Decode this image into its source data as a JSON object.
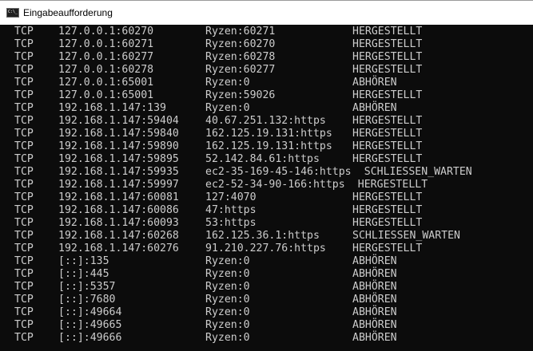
{
  "window": {
    "title": "Eingabeaufforderung",
    "icon": "cmd-icon"
  },
  "colors": {
    "background": "#0c0c0c",
    "text": "#cccccc",
    "titlebar": "#ffffff"
  },
  "connections": [
    [
      "TCP",
      "127.0.0.1:60270",
      "Ryzen:60271",
      "HERGESTELLT"
    ],
    [
      "TCP",
      "127.0.0.1:60271",
      "Ryzen:60270",
      "HERGESTELLT"
    ],
    [
      "TCP",
      "127.0.0.1:60277",
      "Ryzen:60278",
      "HERGESTELLT"
    ],
    [
      "TCP",
      "127.0.0.1:60278",
      "Ryzen:60277",
      "HERGESTELLT"
    ],
    [
      "TCP",
      "127.0.0.1:65001",
      "Ryzen:0",
      "ABHÖREN"
    ],
    [
      "TCP",
      "127.0.0.1:65001",
      "Ryzen:59026",
      "HERGESTELLT"
    ],
    [
      "TCP",
      "192.168.1.147:139",
      "Ryzen:0",
      "ABHÖREN"
    ],
    [
      "TCP",
      "192.168.1.147:59404",
      "40.67.251.132:https",
      "HERGESTELLT"
    ],
    [
      "TCP",
      "192.168.1.147:59840",
      "162.125.19.131:https",
      "HERGESTELLT"
    ],
    [
      "TCP",
      "192.168.1.147:59890",
      "162.125.19.131:https",
      "HERGESTELLT"
    ],
    [
      "TCP",
      "192.168.1.147:59895",
      "52.142.84.61:https",
      "HERGESTELLT"
    ],
    [
      "TCP",
      "192.168.1.147:59935",
      "ec2-35-169-45-146:https",
      "SCHLIESSEN_WARTEN"
    ],
    [
      "TCP",
      "192.168.1.147:59997",
      "ec2-52-34-90-166:https",
      "HERGESTELLT"
    ],
    [
      "TCP",
      "192.168.1.147:60081",
      "127:4070",
      "HERGESTELLT"
    ],
    [
      "TCP",
      "192.168.1.147:60086",
      "47:https",
      "HERGESTELLT"
    ],
    [
      "TCP",
      "192.168.1.147:60093",
      "53:https",
      "HERGESTELLT"
    ],
    [
      "TCP",
      "192.168.1.147:60268",
      "162.125.36.1:https",
      "SCHLIESSEN_WARTEN"
    ],
    [
      "TCP",
      "192.168.1.147:60276",
      "91.210.227.76:https",
      "HERGESTELLT"
    ],
    [
      "TCP",
      "[::]:135",
      "Ryzen:0",
      "ABHÖREN"
    ],
    [
      "TCP",
      "[::]:445",
      "Ryzen:0",
      "ABHÖREN"
    ],
    [
      "TCP",
      "[::]:5357",
      "Ryzen:0",
      "ABHÖREN"
    ],
    [
      "TCP",
      "[::]:7680",
      "Ryzen:0",
      "ABHÖREN"
    ],
    [
      "TCP",
      "[::]:49664",
      "Ryzen:0",
      "ABHÖREN"
    ],
    [
      "TCP",
      "[::]:49665",
      "Ryzen:0",
      "ABHÖREN"
    ],
    [
      "TCP",
      "[::]:49666",
      "Ryzen:0",
      "ABHÖREN"
    ]
  ]
}
